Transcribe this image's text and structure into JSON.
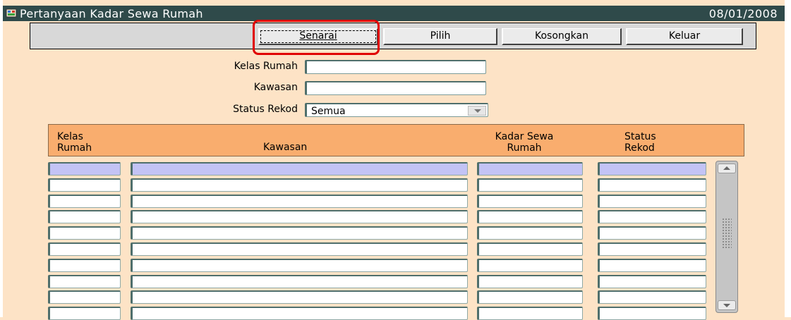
{
  "window": {
    "title": "Pertanyaan Kadar Sewa Rumah",
    "date": "08/01/2008"
  },
  "toolbar": {
    "senarai_label": "Senarai",
    "pilih_label": "Pilih",
    "kosongkan_label": "Kosongkan",
    "keluar_label": "Keluar"
  },
  "form": {
    "kelas_rumah_label": "Kelas Rumah",
    "kelas_rumah_value": "",
    "kawasan_label": "Kawasan",
    "kawasan_value": "",
    "status_rekod_label": "Status Rekod",
    "status_rekod_value": "Semua"
  },
  "grid": {
    "headers": {
      "kelas_rumah_1": "Kelas",
      "kelas_rumah_2": "Rumah",
      "kawasan": "Kawasan",
      "kadar_1": "Kadar Sewa",
      "kadar_2": "Rumah",
      "status_1": "Status",
      "status_2": "Rekod"
    },
    "rows": [
      [
        "",
        "",
        "",
        ""
      ],
      [
        "",
        "",
        "",
        ""
      ],
      [
        "",
        "",
        "",
        ""
      ],
      [
        "",
        "",
        "",
        ""
      ],
      [
        "",
        "",
        "",
        ""
      ],
      [
        "",
        "",
        "",
        ""
      ],
      [
        "",
        "",
        "",
        ""
      ],
      [
        "",
        "",
        "",
        ""
      ],
      [
        "",
        "",
        "",
        ""
      ],
      [
        "",
        "",
        "",
        ""
      ]
    ]
  },
  "colors": {
    "background": "#fde3c6",
    "header": "#f9ad6e",
    "highlight": "#e00000",
    "selected_row": "#c3c3f5",
    "titlebar": "#2f4a4a"
  }
}
